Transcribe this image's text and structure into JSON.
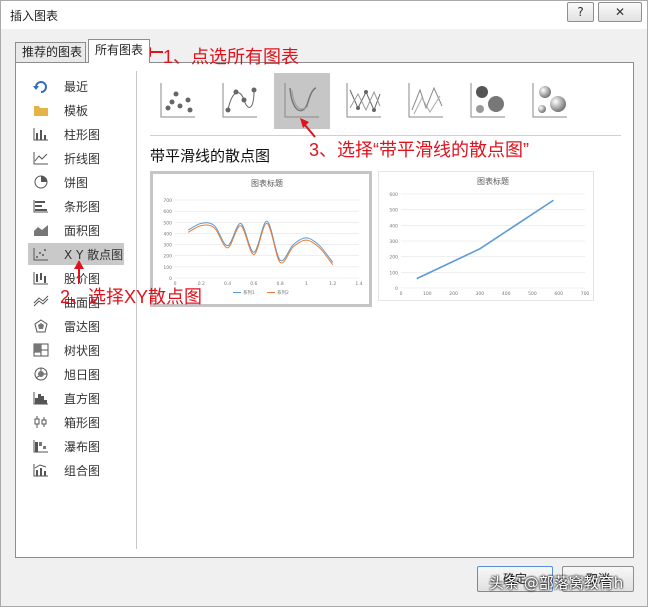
{
  "dialog": {
    "title": "插入图表",
    "help_label": "?",
    "close_label": "✕"
  },
  "tabs": [
    {
      "label": "推荐的图表"
    },
    {
      "label": "所有图表"
    }
  ],
  "sidebar": {
    "items": [
      {
        "label": "最近",
        "icon": "recent-icon"
      },
      {
        "label": "模板",
        "icon": "folder-icon"
      },
      {
        "label": "柱形图",
        "icon": "column-chart-icon"
      },
      {
        "label": "折线图",
        "icon": "line-chart-icon"
      },
      {
        "label": "饼图",
        "icon": "pie-chart-icon"
      },
      {
        "label": "条形图",
        "icon": "bar-chart-icon"
      },
      {
        "label": "面积图",
        "icon": "area-chart-icon"
      },
      {
        "label": "X Y 散点图",
        "icon": "scatter-chart-icon"
      },
      {
        "label": "股价图",
        "icon": "stock-chart-icon"
      },
      {
        "label": "曲面图",
        "icon": "surface-chart-icon"
      },
      {
        "label": "雷达图",
        "icon": "radar-chart-icon"
      },
      {
        "label": "树状图",
        "icon": "treemap-chart-icon"
      },
      {
        "label": "旭日图",
        "icon": "sunburst-chart-icon"
      },
      {
        "label": "直方图",
        "icon": "histogram-chart-icon"
      },
      {
        "label": "箱形图",
        "icon": "box-whisker-chart-icon"
      },
      {
        "label": "瀑布图",
        "icon": "waterfall-chart-icon"
      },
      {
        "label": "组合图",
        "icon": "combo-chart-icon"
      }
    ],
    "selected": "X Y 散点图"
  },
  "subtypes": [
    {
      "icon": "scatter-icon"
    },
    {
      "icon": "scatter-smooth-markers-icon"
    },
    {
      "icon": "scatter-smooth-lines-icon"
    },
    {
      "icon": "scatter-straight-markers-icon"
    },
    {
      "icon": "scatter-straight-lines-icon"
    },
    {
      "icon": "bubble-icon"
    },
    {
      "icon": "bubble-3d-icon"
    }
  ],
  "selected_subtype_title": "带平滑线的散点图",
  "previews": [
    {
      "title": "图表标题",
      "y_ticks": [
        "700",
        "600",
        "500",
        "400",
        "300",
        "200",
        "100",
        "0"
      ],
      "x_ticks": [
        "0",
        "0.2",
        "0.4",
        "0.6",
        "0.8",
        "1",
        "1.2",
        "1.4"
      ],
      "legend": [
        "系列1",
        "系列2"
      ],
      "colors": [
        "#5b9bd5",
        "#ed7d31"
      ]
    },
    {
      "title": "图表标题",
      "y_ticks": [
        "600",
        "500",
        "400",
        "300",
        "200",
        "100",
        "0"
      ],
      "x_ticks": [
        "0",
        "100",
        "200",
        "300",
        "400",
        "500",
        "600",
        "700"
      ],
      "colors": [
        "#5b9bd5"
      ]
    }
  ],
  "chart_data": [
    {
      "type": "line",
      "title": "图表标题",
      "xlim": [
        0,
        1.4
      ],
      "ylim": [
        0,
        700
      ],
      "series": [
        {
          "name": "系列1",
          "x": [
            0.1,
            0.2,
            0.3,
            0.4,
            0.5,
            0.6,
            0.7,
            0.8,
            0.9,
            1.0,
            1.1,
            1.2
          ],
          "y": [
            430,
            490,
            470,
            290,
            490,
            230,
            510,
            160,
            300,
            360,
            290,
            140
          ]
        },
        {
          "name": "系列2",
          "x": [
            0.1,
            0.2,
            0.3,
            0.4,
            0.5,
            0.6,
            0.7,
            0.8,
            0.9,
            1.0,
            1.1,
            1.2
          ],
          "y": [
            410,
            470,
            450,
            270,
            470,
            210,
            490,
            140,
            280,
            340,
            270,
            120
          ]
        }
      ]
    },
    {
      "type": "line",
      "title": "图表标题",
      "xlim": [
        0,
        700
      ],
      "ylim": [
        0,
        600
      ],
      "series": [
        {
          "x": [
            60,
            300,
            580
          ],
          "y": [
            60,
            250,
            560
          ]
        }
      ]
    }
  ],
  "footer": {
    "ok_label": "确定",
    "cancel_label": "取消"
  },
  "annotations": {
    "step1": "1、点选所有图表",
    "step2": "2、选择XY散点图",
    "step3": "3、选择“带平滑线的散点图”"
  },
  "watermark": "头条 @部落窝教育h"
}
